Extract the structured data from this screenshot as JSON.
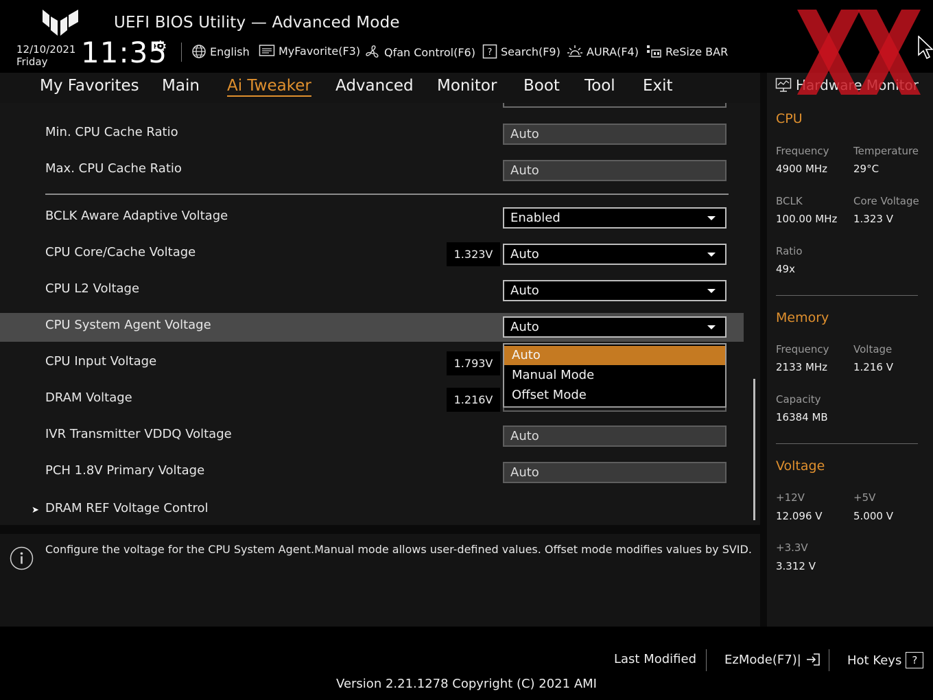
{
  "header": {
    "title": "UEFI BIOS Utility — Advanced Mode",
    "date": "12/10/2021",
    "day": "Friday",
    "time": "11:35",
    "toolbar": {
      "language": "English",
      "my_favorite": "MyFavorite(F3)",
      "qfan": "Qfan Control(F6)",
      "search": "Search(F9)",
      "aura": "AURA(F4)",
      "resize_bar": "ReSize BAR"
    }
  },
  "nav": {
    "tabs": [
      "My Favorites",
      "Main",
      "Ai Tweaker",
      "Advanced",
      "Monitor",
      "Boot",
      "Tool",
      "Exit"
    ],
    "active": "Ai Tweaker"
  },
  "settings": [
    {
      "label": "Min. CPU Cache Ratio",
      "value": "Auto"
    },
    {
      "label": "Max. CPU Cache Ratio",
      "value": "Auto"
    },
    {
      "label": "BCLK Aware Adaptive Voltage",
      "value": "Enabled"
    },
    {
      "label": "CPU Core/Cache Voltage",
      "value": "Auto",
      "reading": "1.323V"
    },
    {
      "label": "CPU L2 Voltage",
      "value": "Auto"
    },
    {
      "label": "CPU System Agent Voltage",
      "value": "Auto"
    },
    {
      "label": "CPU Input Voltage",
      "value": "",
      "reading": "1.793V"
    },
    {
      "label": "DRAM Voltage",
      "value": "",
      "reading": "1.216V"
    },
    {
      "label": "IVR Transmitter VDDQ Voltage",
      "value": "Auto"
    },
    {
      "label": "PCH 1.8V Primary Voltage",
      "value": "Auto"
    },
    {
      "label": "DRAM REF Voltage Control"
    }
  ],
  "dropdown": {
    "options": [
      "Auto",
      "Manual Mode",
      "Offset Mode"
    ],
    "selected": "Auto"
  },
  "help_text": "Configure the voltage for the CPU System Agent.Manual mode allows user-defined values. Offset mode modifies values by SVID.",
  "footer": {
    "last_modified": "Last Modified",
    "ezmode": "EzMode(F7)|",
    "hotkeys": "Hot Keys",
    "hotkeys_icon": "?",
    "version": "Version 2.21.1278 Copyright (C) 2021 AMI"
  },
  "hw_monitor": {
    "title": "Hardware Monitor",
    "cpu": {
      "heading": "CPU",
      "frequency_label": "Frequency",
      "frequency": "4900 MHz",
      "temperature_label": "Temperature",
      "temperature": "29°C",
      "bclk_label": "BCLK",
      "bclk": "100.00 MHz",
      "core_voltage_label": "Core Voltage",
      "core_voltage": "1.323 V",
      "ratio_label": "Ratio",
      "ratio": "49x"
    },
    "memory": {
      "heading": "Memory",
      "frequency_label": "Frequency",
      "frequency": "2133 MHz",
      "voltage_label": "Voltage",
      "voltage": "1.216 V",
      "capacity_label": "Capacity",
      "capacity": "16384 MB"
    },
    "voltage": {
      "heading": "Voltage",
      "v12_label": "+12V",
      "v12": "12.096 V",
      "v5_label": "+5V",
      "v5": "5.000 V",
      "v33_label": "+3.3V",
      "v33": "3.312 V"
    }
  },
  "colors": {
    "accent": "#e0902e",
    "dropdown_selected": "#c57a22",
    "watermark": "#c8141e"
  }
}
